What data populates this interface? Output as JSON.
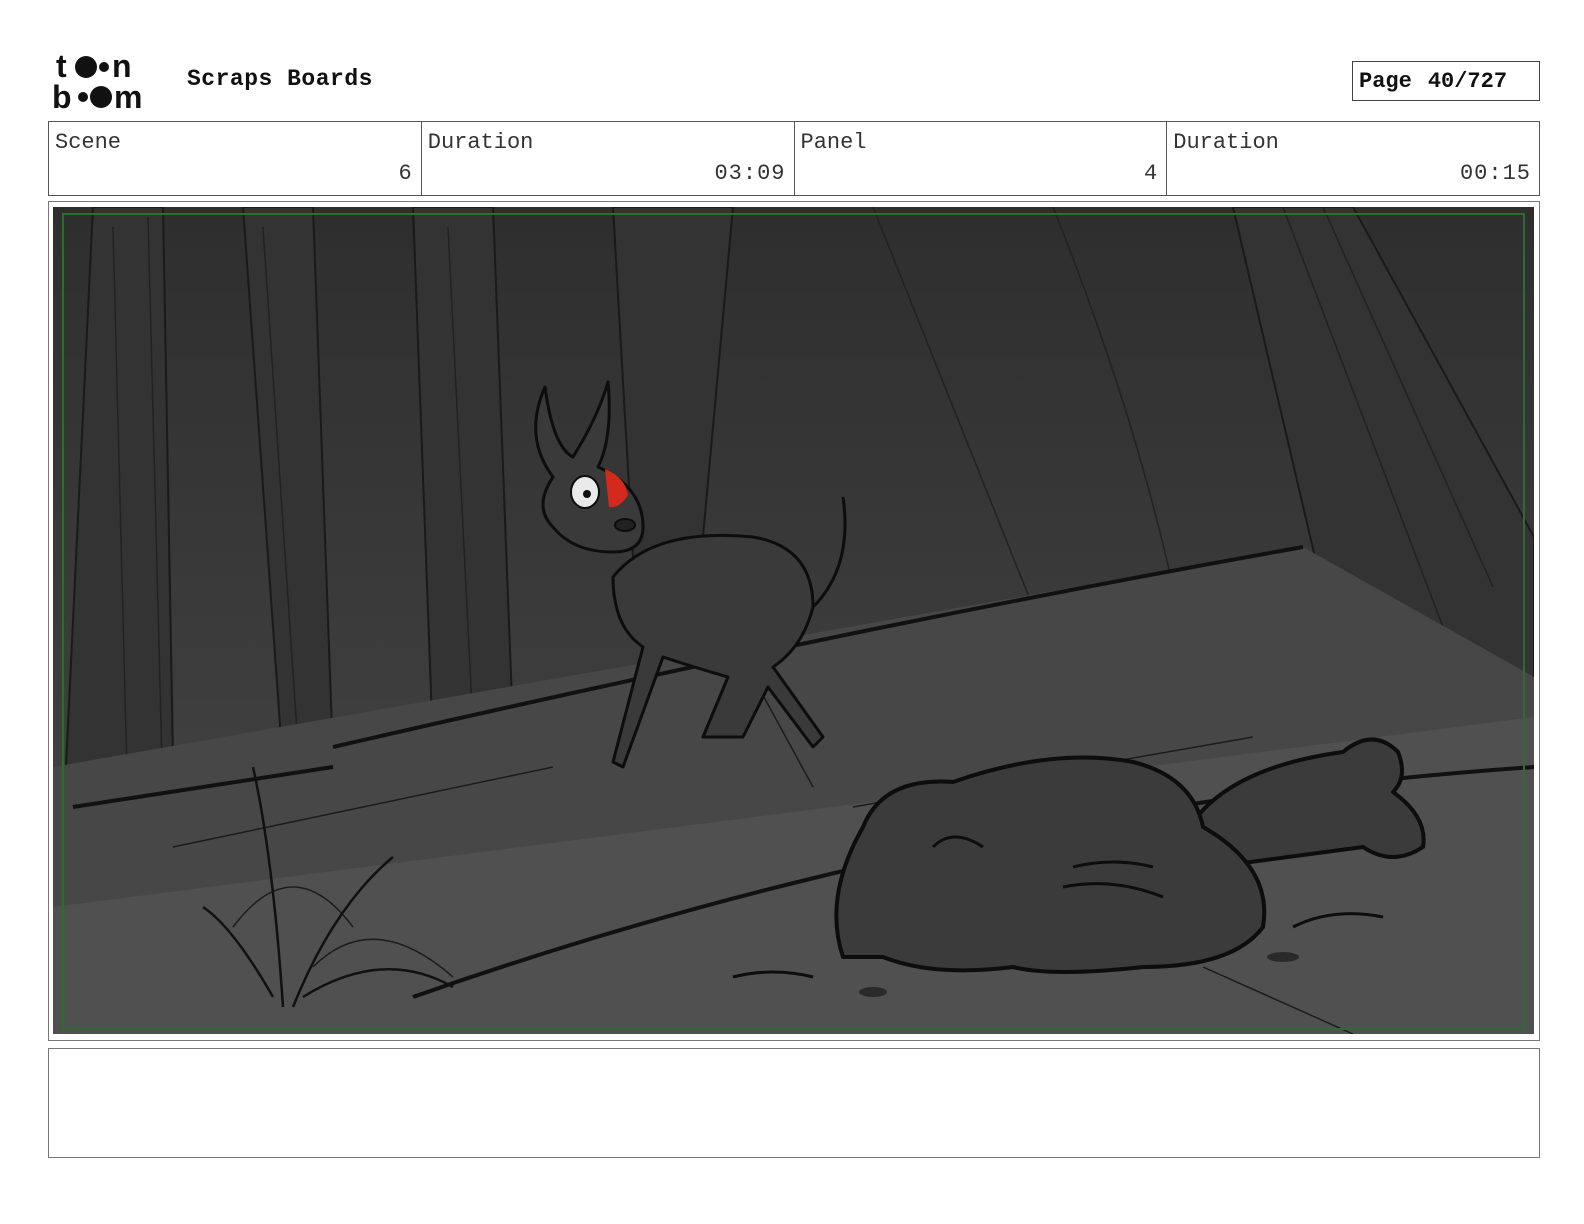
{
  "header": {
    "logo_text": "toon boom",
    "title": "Scraps Boards",
    "page_label": "Page",
    "page_value": "40/727"
  },
  "info": [
    {
      "label": "Scene",
      "value": "6"
    },
    {
      "label": "Duration",
      "value": "03:09"
    },
    {
      "label": "Panel",
      "value": "4"
    },
    {
      "label": "Duration",
      "value": "00:15"
    }
  ],
  "panel": {
    "background": "#3d3d3d",
    "frame_color": "#2e6b2e",
    "accent": "#d42a1e"
  },
  "notes": {
    "text": ""
  }
}
